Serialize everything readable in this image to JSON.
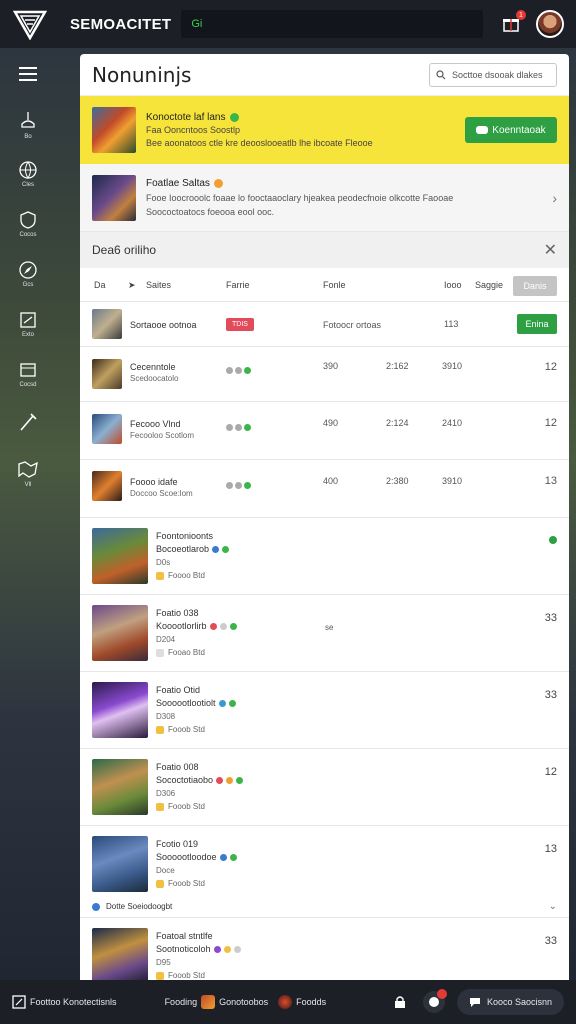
{
  "app": {
    "brand": "SEMOACITET",
    "search_text": "Gi",
    "notif_count": "1"
  },
  "leftnav": [
    {
      "icon": "trophy-icon",
      "label": "Bo"
    },
    {
      "icon": "globe-icon",
      "label": "Cles"
    },
    {
      "icon": "shield-icon",
      "label": "Cocos"
    },
    {
      "icon": "compass-icon",
      "label": "Gcs"
    },
    {
      "icon": "book-icon",
      "label": "Exto"
    },
    {
      "icon": "cards-icon",
      "label": "Cocsd"
    },
    {
      "icon": "sword-icon",
      "label": ""
    },
    {
      "icon": "flag-icon",
      "label": "Vll"
    }
  ],
  "panel": {
    "title": "Nonuninjs",
    "search_placeholder": "Socttoe dsooak dlakes"
  },
  "promo": {
    "title": "Konoctote laf lans",
    "line1": "Faa Ooncntoos Soostlp",
    "line2": "Bee aoonatoos ctle kre deooslooeatlb lhe ibcoate Fleooe",
    "button": "Koenntaoak"
  },
  "notice": {
    "title": "Foatlae Saltas",
    "line1": "Fooe Ioocrooolc foaae lo fooctaaoclary hjeakea peodecfnoie olkcotte Faooae",
    "line2": "Soococtoatocs foeooa eool ooc."
  },
  "section": {
    "title": "Dea6 oriliho"
  },
  "table": {
    "headers": [
      "Da",
      "Saites",
      "Farrie",
      "Fonle",
      "Iooo",
      "Saggie"
    ],
    "filter_label": "Danis",
    "rows": [
      {
        "name": "Sortaooe ootnoa",
        "sub": "",
        "tag": "TDIS",
        "c1": "Fotoocr ortoas",
        "c2": "",
        "c3": "113",
        "action": "Enina"
      },
      {
        "name": "Cecenntole",
        "sub": "Scedoocatolo",
        "tag": "",
        "c1": "390",
        "c2": "2:162",
        "c3": "3910",
        "val": "12"
      },
      {
        "name": "Fecooo Vlnd",
        "sub": "Fecooloo Scotlom",
        "tag": "",
        "c1": "490",
        "c2": "2:124",
        "c3": "2410",
        "val": "12"
      },
      {
        "name": "Foooo idafe",
        "sub": "Doccoo Scoe:lom",
        "tag": "",
        "c1": "400",
        "c2": "2:380",
        "c3": "3910",
        "val": "13"
      }
    ]
  },
  "list": [
    {
      "title": "Foontonioonts",
      "sub": "Bocoeotlarob",
      "line3": "D0s",
      "line4": "Foooo Btd",
      "val": ""
    },
    {
      "title": "Foatio 038",
      "sub": "Kooootlorlirb",
      "line3": "D204",
      "line4": "Fooao Btd",
      "val": "33",
      "extra": "se"
    },
    {
      "title": "Foatio Otid",
      "sub": "Soooootlootiolt",
      "line3": "D308",
      "line4": "Fooob Std",
      "val": "33"
    },
    {
      "title": "Foatio 008",
      "sub": "Sococtotiaobo",
      "line3": "D306",
      "line4": "Fooob Std",
      "val": "12"
    },
    {
      "title": "Fcotio 019",
      "sub": "Soooootloodoe",
      "line3": "Doce",
      "line4": "Fooob Std",
      "val": "13"
    },
    {
      "title": "Foatoal stntlfe",
      "sub": "Sootnoticoloh",
      "line3": "D95",
      "line4": "Fooob Std",
      "val": "33"
    }
  ],
  "expander": {
    "label": "Dotte Soeiodoogbt"
  },
  "bottombar": {
    "left": "Foottoo Konotectisnls",
    "mid1": "Fooding",
    "mid2": "Gonotoobos",
    "mid3": "Foodds",
    "pill": "Kooco Saocisnn"
  }
}
